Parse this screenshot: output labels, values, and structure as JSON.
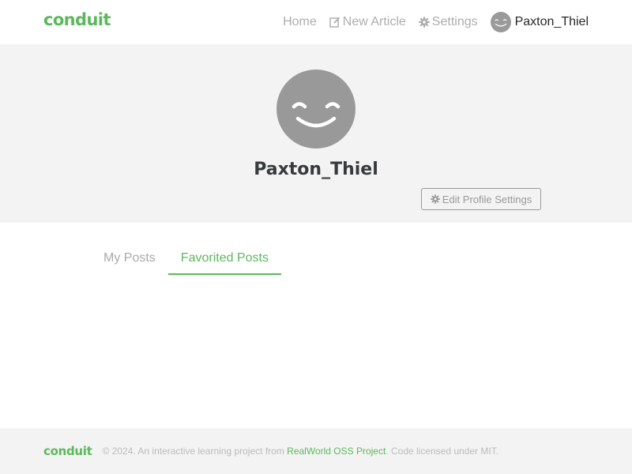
{
  "navbar": {
    "brand": "conduit",
    "links": {
      "home": "Home",
      "new_article": "New Article",
      "settings": "Settings",
      "username": "Paxton_Thiel"
    }
  },
  "profile": {
    "username": "Paxton_Thiel",
    "edit_button_label": "Edit Profile Settings"
  },
  "tabs": {
    "my_posts": "My Posts",
    "favorited_posts": "Favorited Posts",
    "active": "Favorited Posts"
  },
  "footer": {
    "logo": "conduit",
    "attribution_prefix": "© 2024. An interactive learning project from",
    "attribution_link": "RealWorld OSS Project",
    "attribution_suffix": ". Code licensed under MIT."
  },
  "colors": {
    "brand": "#5cb85c",
    "banner_bg": "#f3f3f3",
    "avatar_bg": "#999999"
  },
  "icons": [
    "compose-icon",
    "gear-icon",
    "smiley-avatar"
  ]
}
